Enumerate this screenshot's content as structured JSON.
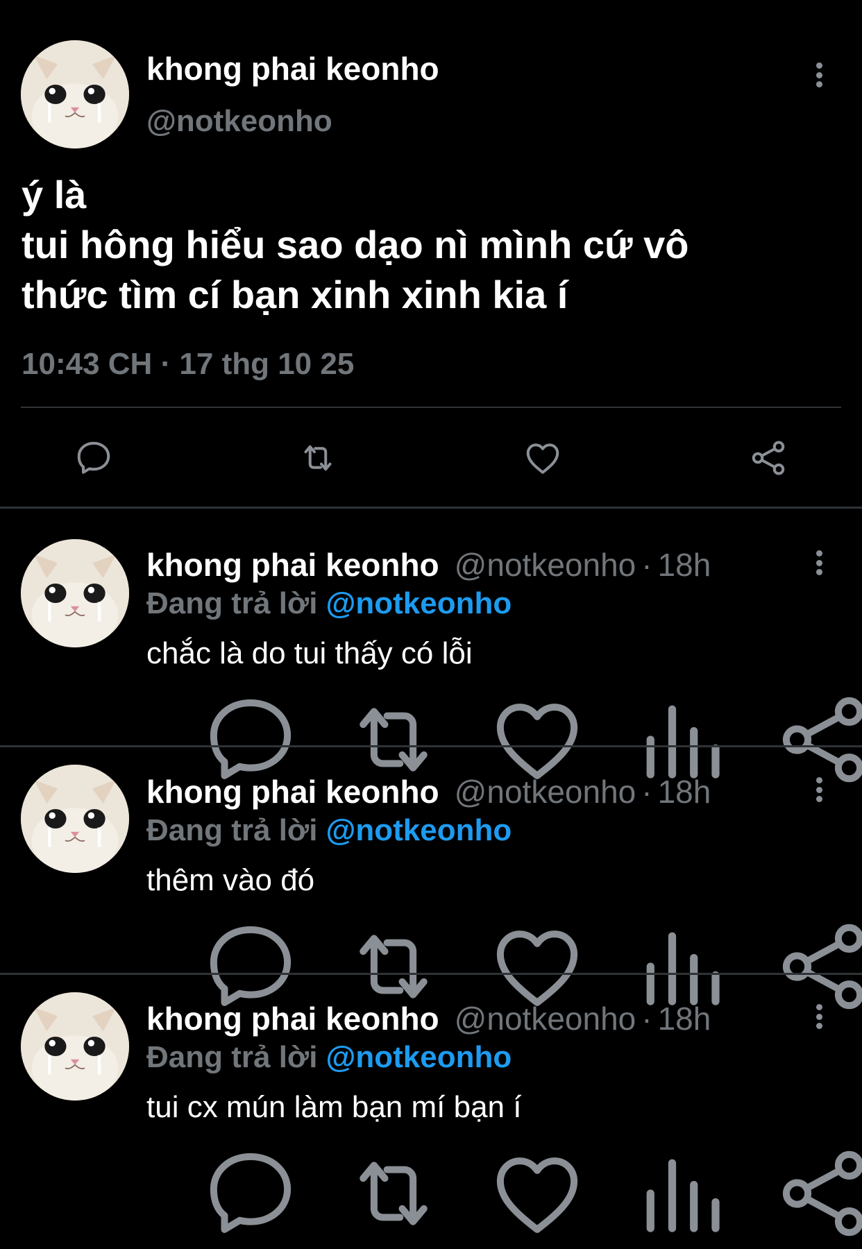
{
  "main_tweet": {
    "author_name": "khong phai keonho",
    "handle": "@notkeonho",
    "lines": [
      "ý là",
      "tui hông hiểu sao dạo nì mình cứ vô",
      "thức tìm cí bạn xinh xinh kia í"
    ],
    "timestamp": "10:43 CH · 17 thg 10 25",
    "actions": [
      "reply-icon",
      "retweet-icon",
      "like-icon",
      "share-icon"
    ]
  },
  "replies": [
    {
      "author_name": "khong phai keonho",
      "handle": "@notkeonho",
      "dot": "·",
      "time": "18h",
      "replying_label": "Đang trả lời",
      "replying_to": "@notkeonho",
      "text": "chắc là do tui thấy có lỗi"
    },
    {
      "author_name": "khong phai keonho",
      "handle": "@notkeonho",
      "dot": "·",
      "time": "18h",
      "replying_label": "Đang trả lời",
      "replying_to": "@notkeonho",
      "text": "thêm vào đó"
    },
    {
      "author_name": "khong phai keonho",
      "handle": "@notkeonho",
      "dot": "·",
      "time": "18h",
      "replying_label": "Đang trả lời",
      "replying_to": "@notkeonho",
      "text": "tui cx mún làm bạn mí bạn í"
    }
  ],
  "reply_actions": [
    "reply-icon",
    "retweet-icon",
    "like-icon",
    "views-icon",
    "share-icon"
  ],
  "colors": {
    "background": "#000000",
    "text": "#ffffff",
    "secondary": "#71767b",
    "mention": "#1d9bf0",
    "divider": "#2f3336"
  }
}
